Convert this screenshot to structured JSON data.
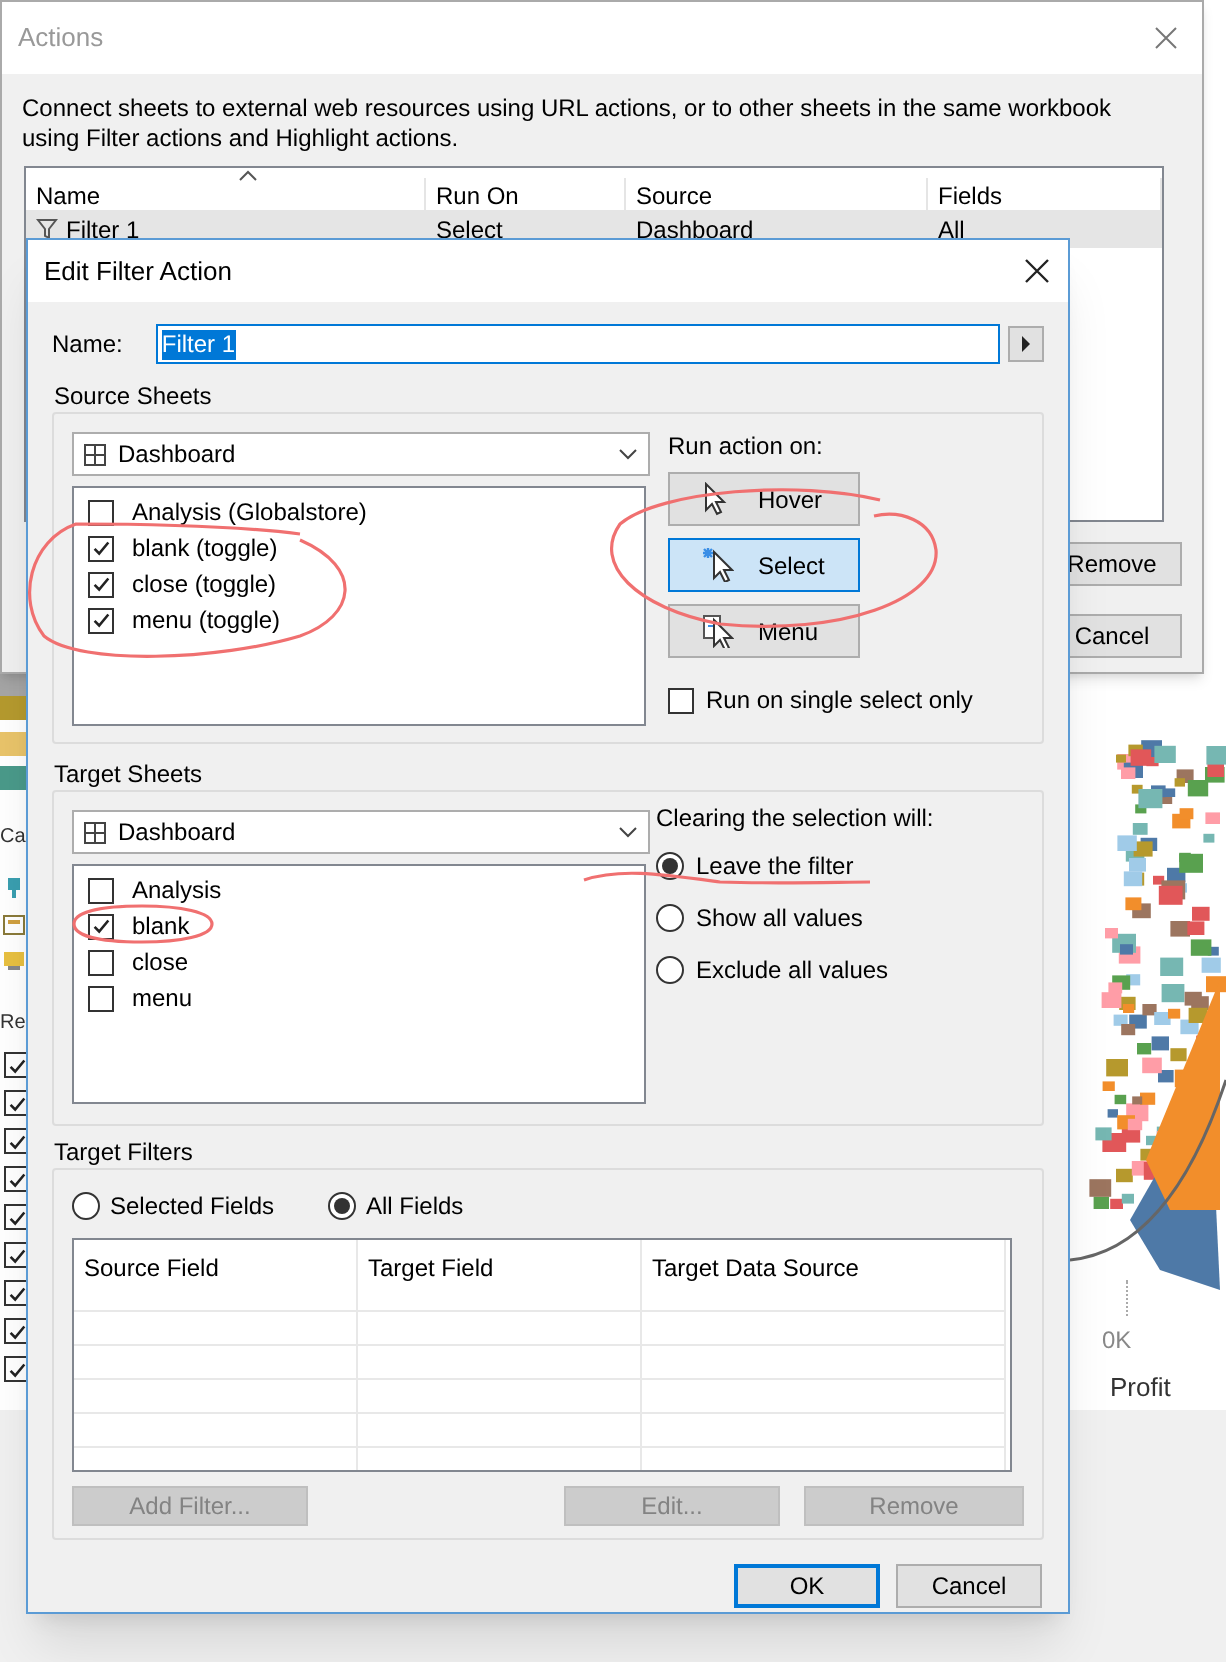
{
  "background": {
    "left_labels": [
      "Ca",
      "Re"
    ],
    "filter_checkboxes": [
      {
        "checked": true
      },
      {
        "checked": true
      },
      {
        "checked": true
      },
      {
        "checked": true
      },
      {
        "checked": true
      },
      {
        "checked": true
      },
      {
        "checked": true
      },
      {
        "checked": true
      },
      {
        "checked": true
      }
    ],
    "chart": {
      "axis_tick": "0K",
      "axis_title": "Profit"
    }
  },
  "actions_window": {
    "title": "Actions",
    "description": "Connect sheets to external web resources using URL actions, or to other sheets in the same workbook using Filter actions and Highlight actions.",
    "table": {
      "columns": [
        "Name",
        "Run On",
        "Source",
        "Fields"
      ],
      "rows": [
        {
          "cells": [
            "Filter 1",
            "Select",
            "Dashboard",
            "All"
          ],
          "selected": true
        }
      ]
    },
    "buttons": [
      "Remove",
      "Cancel"
    ]
  },
  "edit_dialog": {
    "title": "Edit Filter Action",
    "name_label": "Name:",
    "name_value": "Filter 1",
    "source_sheets": {
      "title": "Source Sheets",
      "dropdown": "Dashboard",
      "sheets": [
        {
          "label": "Analysis (Globalstore)",
          "checked": false
        },
        {
          "label": "blank (toggle)",
          "checked": true
        },
        {
          "label": "close (toggle)",
          "checked": true
        },
        {
          "label": "menu (toggle)",
          "checked": true
        }
      ],
      "run_action_label": "Run action on:",
      "run_actions": [
        {
          "label": "Hover",
          "selected": false
        },
        {
          "label": "Select",
          "selected": true
        },
        {
          "label": "Menu",
          "selected": false
        }
      ],
      "single_select": {
        "label": "Run on single select only",
        "checked": false
      }
    },
    "target_sheets": {
      "title": "Target Sheets",
      "dropdown": "Dashboard",
      "sheets": [
        {
          "label": "Analysis",
          "checked": false
        },
        {
          "label": "blank",
          "checked": true
        },
        {
          "label": "close",
          "checked": false
        },
        {
          "label": "menu",
          "checked": false
        }
      ],
      "clearing_label": "Clearing the selection will:",
      "clearing_options": [
        {
          "label": "Leave the filter",
          "selected": true
        },
        {
          "label": "Show all values",
          "selected": false
        },
        {
          "label": "Exclude all values",
          "selected": false
        }
      ]
    },
    "target_filters": {
      "title": "Target Filters",
      "scope_options": [
        {
          "label": "Selected Fields",
          "selected": false
        },
        {
          "label": "All Fields",
          "selected": true
        }
      ],
      "columns": [
        "Source Field",
        "Target Field",
        "Target Data Source"
      ],
      "buttons": [
        {
          "label": "Add Filter...",
          "disabled": true
        },
        {
          "label": "Edit...",
          "disabled": true
        },
        {
          "label": "Remove",
          "disabled": true
        }
      ]
    },
    "buttons": [
      {
        "label": "OK",
        "kind": "default"
      },
      {
        "label": "Cancel",
        "kind": "normal"
      }
    ]
  }
}
